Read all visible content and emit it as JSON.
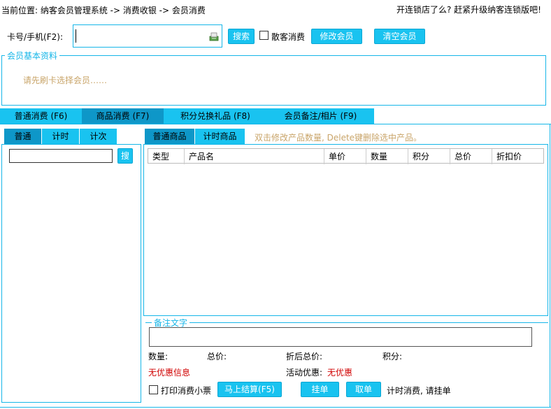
{
  "breadcrumb": "当前位置: 纳客会员管理系统 -> 消费收银 -> 会员消费",
  "promo": "开连锁店了么? 赶紧升级纳客连锁版吧!",
  "search": {
    "label": "卡号/手机(F2):",
    "value": "",
    "search_btn": "搜索",
    "walkin_label": "散客消费",
    "edit_member_btn": "修改会员",
    "clear_member_btn": "清空会员"
  },
  "member_info": {
    "legend": "会员基本资料",
    "placeholder": "请先刷卡选择会员……"
  },
  "main_tabs": [
    {
      "label": "普通消费 (F6)"
    },
    {
      "label": "商品消费 (F7)"
    },
    {
      "label": "积分兑换礼品 (F8)"
    },
    {
      "label": "会员备注/相片 (F9)"
    }
  ],
  "left_tabs": [
    {
      "label": "普通"
    },
    {
      "label": "计时"
    },
    {
      "label": "计次"
    }
  ],
  "left_search_btn": "搜",
  "right_tabs": [
    {
      "label": "普通商品"
    },
    {
      "label": "计时商品"
    }
  ],
  "hint": "双击修改产品数量, Delete键删除选中产品。",
  "table_columns": [
    "类型",
    "产品名",
    "单价",
    "数量",
    "积分",
    "总价",
    "折扣价"
  ],
  "remarks_legend": "备注文字",
  "summary": {
    "qty_label": "数量:",
    "total_label": "总价:",
    "discounted_label": "折后总价:",
    "points_label": "积分:",
    "no_discount": "无优惠信息",
    "activity_label": "活动优惠:",
    "activity_value": "无优惠"
  },
  "actions": {
    "print_label": "打印消费小票",
    "checkout_btn": "马上结算(F5)",
    "hold_btn": "挂单",
    "retrieve_btn": "取单",
    "timer_hint": "计时消费, 请挂单"
  }
}
